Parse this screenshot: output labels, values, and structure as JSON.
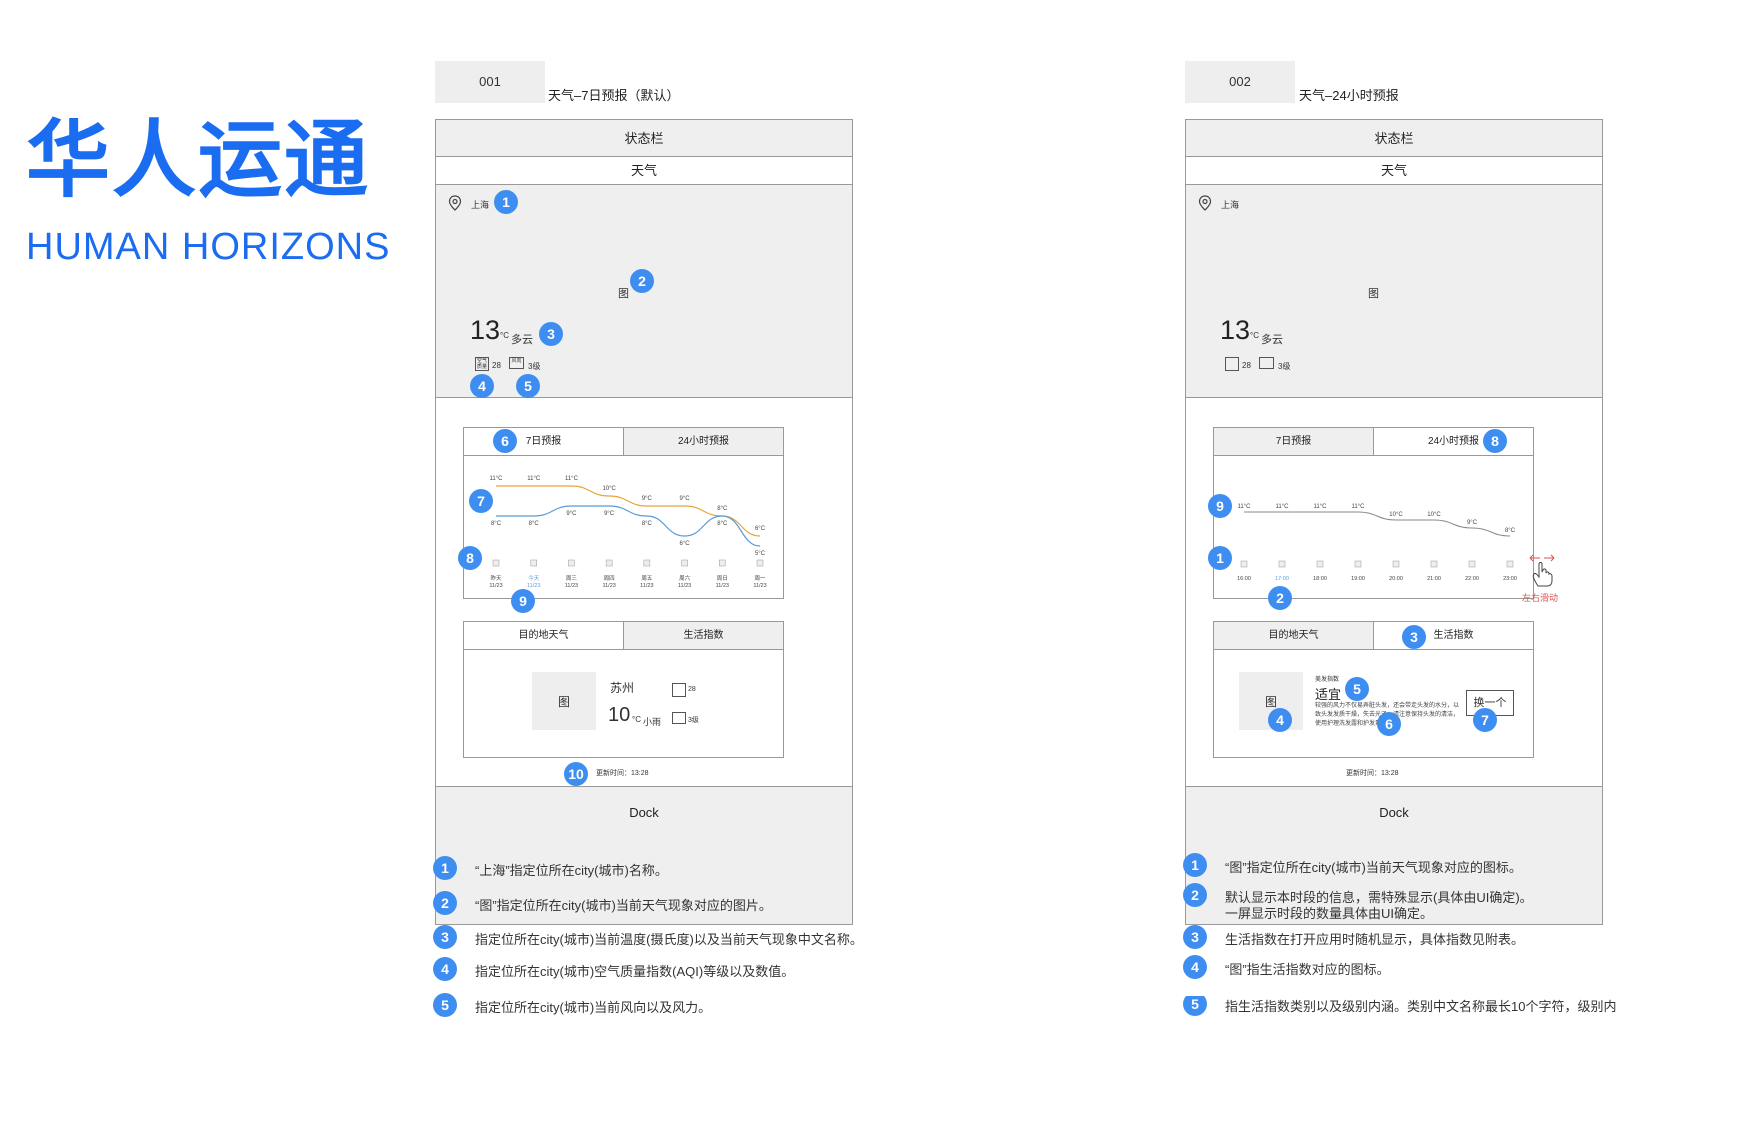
{
  "logo": {
    "cn": "华人运通",
    "en": "HUMAN HORIZONS"
  },
  "pages": [
    {
      "id": "001",
      "title": "天气–7日预报（默认）",
      "status_bar": "状态栏",
      "nav_title": "天气",
      "city": "上海",
      "weather_img": "图",
      "temp": "13",
      "unit": "°C",
      "condition": "多云",
      "aqi": "28",
      "wind": "3级",
      "aqi_icon": "空气质量",
      "wind_icon": "风向",
      "tabs": [
        "7日预报",
        "24小时预报"
      ],
      "chart_icon": "图",
      "chart_data": {
        "type": "line",
        "categories": [
          "昨天\n11/23",
          "今天\n11/23",
          "周三\n11/23",
          "周四\n11/23",
          "周五\n11/23",
          "周六\n11/23",
          "周日\n11/23",
          "周一\n11/23"
        ],
        "series": [
          {
            "values": [
              11,
              11,
              11,
              10,
              9,
              9,
              8,
              6
            ],
            "color": "#e8a33a"
          },
          {
            "values": [
              8,
              8,
              9,
              9,
              8,
              6,
              8,
              5
            ],
            "color": "#5b9bd5"
          }
        ],
        "high_labels": [
          "11°C",
          "11°C",
          "11°C",
          "10°C",
          "9°C",
          "9°C",
          "8°C",
          "6°C"
        ],
        "low_labels": [
          "8°C",
          "8°C",
          "9°C",
          "9°C",
          "8°C",
          "6°C",
          "8°C",
          "5°C"
        ]
      },
      "day_labels": [
        {
          "day": "昨天",
          "date": "11/23"
        },
        {
          "day": "今天",
          "date": "11/23"
        },
        {
          "day": "周三",
          "date": "11/23"
        },
        {
          "day": "周四",
          "date": "11/23"
        },
        {
          "day": "周五",
          "date": "11/23"
        },
        {
          "day": "周六",
          "date": "11/23"
        },
        {
          "day": "周日",
          "date": "11/23"
        },
        {
          "day": "周一",
          "date": "11/23"
        }
      ],
      "bottom_tabs": [
        "目的地天气",
        "生活指数"
      ],
      "dest": {
        "img": "图",
        "city": "苏州",
        "temp": "10",
        "unit": "°C",
        "condition": "小雨",
        "aqi": "28",
        "wind": "3级"
      },
      "update": "更新时间：13:28",
      "dock": "Dock",
      "notes": [
        "“上海”指定位所在city(城市)名称。",
        "“图”指定位所在city(城市)当前天气现象对应的图片。",
        "指定位所在city(城市)当前温度(摄氏度)以及当前天气现象中文名称。",
        "指定位所在city(城市)空气质量指数(AQI)等级以及数值。",
        "指定位所在city(城市)当前风向以及风力。"
      ]
    },
    {
      "id": "002",
      "title": "天气–24小时预报",
      "status_bar": "状态栏",
      "nav_title": "天气",
      "city": "上海",
      "weather_img": "图",
      "temp": "13",
      "unit": "°C",
      "condition": "多云",
      "aqi": "28",
      "wind": "3级",
      "tabs": [
        "7日预报",
        "24小时预报"
      ],
      "chart_icon": "图",
      "chart_data": {
        "type": "line",
        "categories": [
          "16:00",
          "17:00",
          "18:00",
          "19:00",
          "20:00",
          "21:00",
          "22:00",
          "23:00"
        ],
        "series": [
          {
            "values": [
              11,
              11,
              11,
              11,
              10,
              10,
              9,
              8
            ],
            "color": "#888888"
          }
        ],
        "labels": [
          "11°C",
          "11°C",
          "11°C",
          "11°C",
          "10°C",
          "10°C",
          "9°C",
          "8°C"
        ]
      },
      "hours": [
        "16:00",
        "17:00",
        "18:00",
        "19:00",
        "20:00",
        "21:00",
        "22:00",
        "23:00"
      ],
      "swipe_hint": "左右滑动",
      "bottom_tabs": [
        "目的地天气",
        "生活指数"
      ],
      "life": {
        "img": "图",
        "name": "美发指数",
        "level": "适宜",
        "desc": "较强的风力不仅易弄脏头发，还会带走头发的水分，以致头发发质干燥，失去光泽，请注意保持头发的清洁，使用护理洗发露和护发素",
        "button": "换一个"
      },
      "update": "更新时间：13:28",
      "dock": "Dock",
      "notes": [
        "“图”指定位所在city(城市)当前天气现象对应的图标。",
        "默认显示本时段的信息，需特殊显示(具体由UI确定)。",
        "一屏显示时段的数量具体由UI确定。",
        "生活指数在打开应用时随机显示，具体指数见附表。",
        "“图”指生活指数对应的图标。",
        "指生活指数类别以及级别内涵。类别中文名称最长10个字符，级别内"
      ]
    }
  ]
}
